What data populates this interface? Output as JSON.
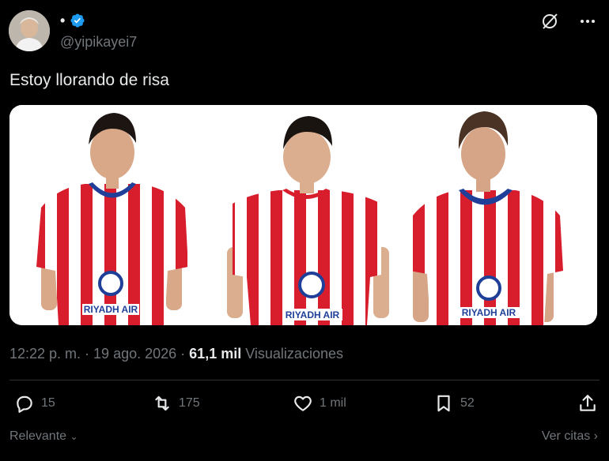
{
  "author": {
    "display_name": "•",
    "handle": "@yipikayei7",
    "verified_icon": "verified-badge-icon",
    "avatar_icon": "avatar-photo"
  },
  "header_icons": [
    "grok-icon",
    "more-icon"
  ],
  "tweet": {
    "text": "Estoy llorando de risa",
    "media": {
      "description_icon": "photo-three-football-players",
      "jersey_sponsor": "RIYADH AIR",
      "colors": {
        "stripe_red": "#d81e2c",
        "stripe_white": "#ffffff",
        "collar_blue": "#1f3f99"
      }
    }
  },
  "meta": {
    "timestamp": "12:22 p. m. · 19 ago. 2026 ·",
    "views_count": "61,1 mil",
    "views_label": "Visualizaciones"
  },
  "actions": {
    "replies": "15",
    "reposts": "175",
    "likes": "1 mil",
    "bookmarks": "52"
  },
  "footer": {
    "sort_label": "Relevante",
    "quotes_label": "Ver citas"
  },
  "colors": {
    "background": "#000000",
    "text": "#e7e9ea",
    "muted": "#71767b",
    "verified": "#1d9bf0",
    "divider": "#2f3336"
  }
}
